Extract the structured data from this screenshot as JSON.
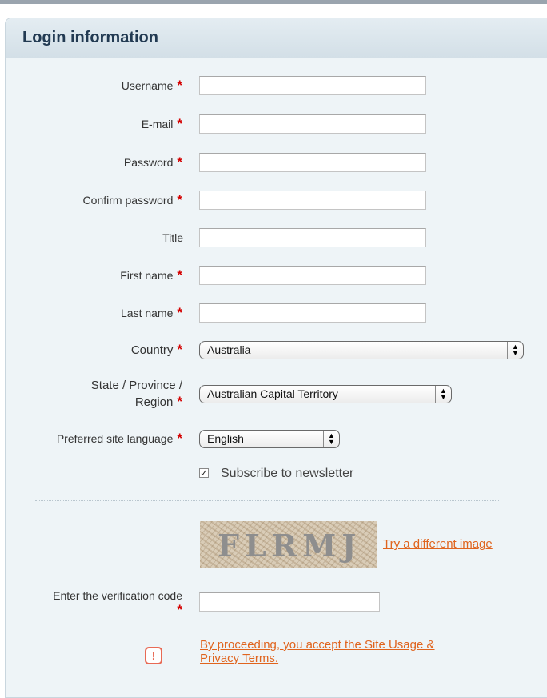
{
  "section": {
    "title": "Login information"
  },
  "required_marker": "*",
  "fields": {
    "username": {
      "label": "Username",
      "value": ""
    },
    "email": {
      "label": "E-mail",
      "value": ""
    },
    "password": {
      "label": "Password",
      "value": ""
    },
    "confirm_password": {
      "label": "Confirm password",
      "value": ""
    },
    "title": {
      "label": "Title",
      "value": ""
    },
    "first_name": {
      "label": "First name",
      "value": ""
    },
    "last_name": {
      "label": "Last name",
      "value": ""
    },
    "country": {
      "label": "Country",
      "selected": "Australia"
    },
    "state": {
      "label_line1": "State / Province /",
      "label_line2": "Region",
      "selected": "Australian Capital Territory"
    },
    "language": {
      "label": "Preferred site language",
      "selected": "English"
    }
  },
  "newsletter": {
    "label": "Subscribe to newsletter",
    "checked": true
  },
  "captcha": {
    "image_text": "FLRMJ",
    "refresh_link": "Try a different image"
  },
  "verification": {
    "label": "Enter the verification code",
    "value": ""
  },
  "terms": {
    "text": "By proceeding, you accept the Site Usage & Privacy Terms.",
    "line1": "By proceeding, you accept the Site Usage &",
    "line2": "Privacy Terms."
  },
  "colors": {
    "required": "#d40000",
    "link": "#e0641e",
    "panel_bg": "#eef4f7",
    "header_title": "#223a52"
  },
  "icons": {
    "select_arrows": "updown-arrows-icon",
    "checkbox": "checkmark-icon",
    "warning": "exclamation-icon"
  }
}
